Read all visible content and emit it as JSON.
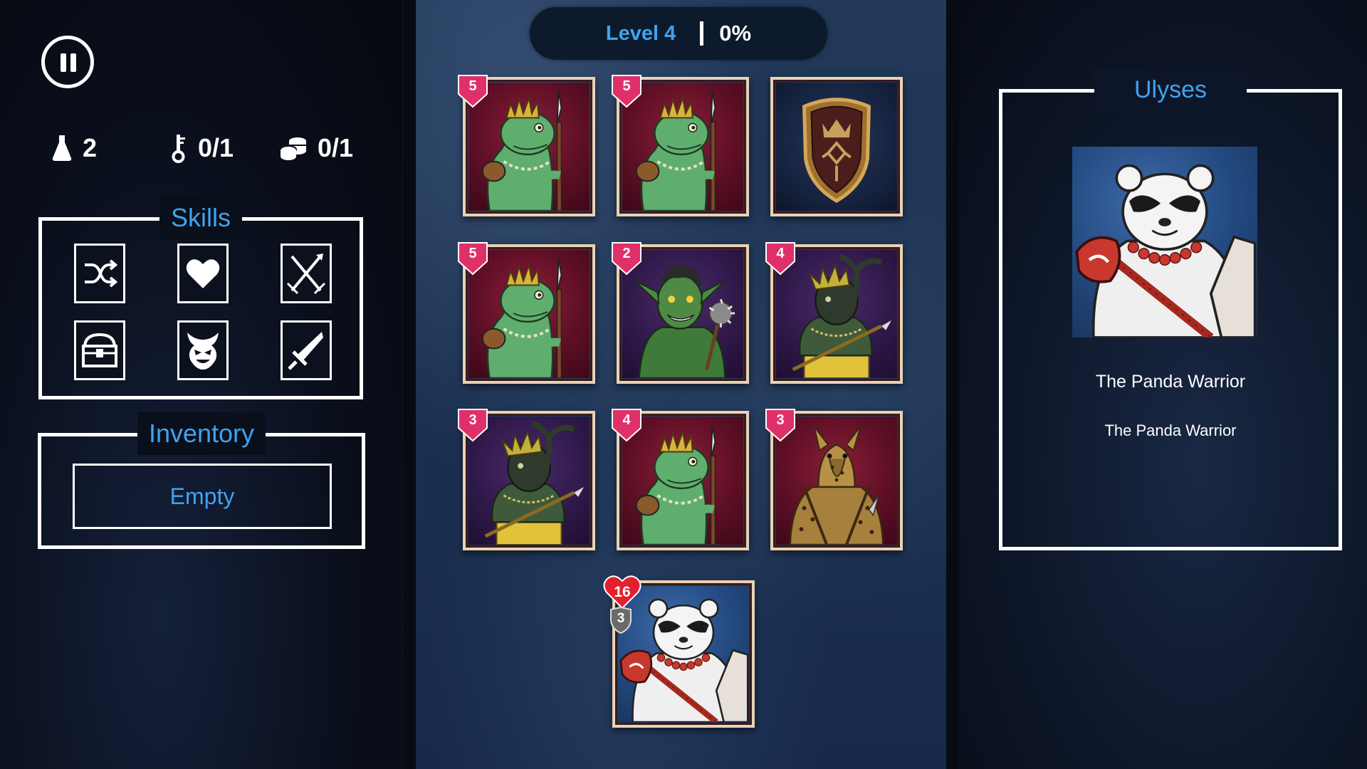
{
  "hud": {
    "potions": "2",
    "keys": "0/1",
    "coins": "0/1"
  },
  "skills": {
    "title": "Skills",
    "items": [
      {
        "name": "shuffle-icon"
      },
      {
        "name": "heart-icon"
      },
      {
        "name": "crossed-swords-icon"
      },
      {
        "name": "treasure-chest-icon"
      },
      {
        "name": "demon-face-icon"
      },
      {
        "name": "sword-icon"
      }
    ]
  },
  "inventory": {
    "title": "Inventory",
    "empty_label": "Empty"
  },
  "level": {
    "label": "Level 4",
    "progress": "0%"
  },
  "board": {
    "cards": [
      {
        "kind": "lizard-spearman",
        "value": "5"
      },
      {
        "kind": "lizard-spearman",
        "value": "5"
      },
      {
        "kind": "shield"
      },
      {
        "kind": "lizard-spearman",
        "value": "5"
      },
      {
        "kind": "goblin-mace",
        "value": "2"
      },
      {
        "kind": "shaman",
        "value": "4"
      },
      {
        "kind": "shaman",
        "value": "3"
      },
      {
        "kind": "lizard-spearman",
        "value": "4"
      },
      {
        "kind": "hyena",
        "value": "3"
      }
    ],
    "player": {
      "kind": "panda-warrior",
      "health": "16",
      "armor": "3"
    }
  },
  "hero": {
    "title": "Ulyses",
    "name": "The Panda Warrior",
    "description": "The Panda Warrior"
  },
  "colors": {
    "accent": "#3fa3ee",
    "badge": "#e0306a",
    "card_border": "#e8d2b6"
  }
}
